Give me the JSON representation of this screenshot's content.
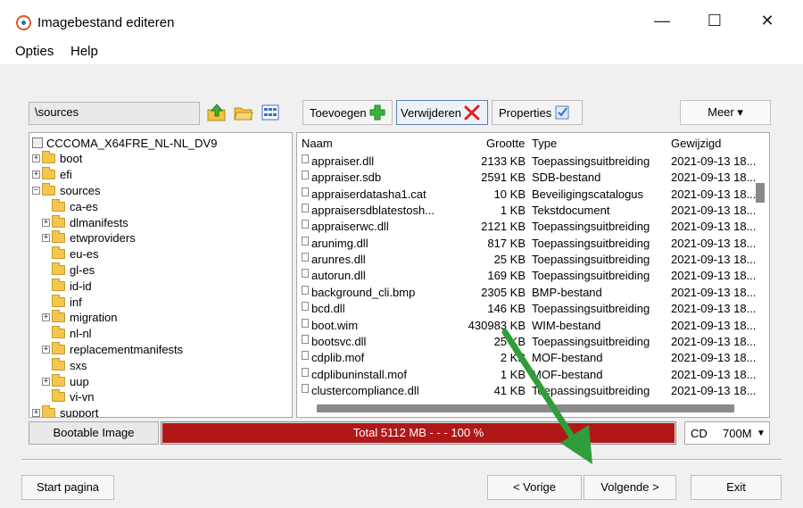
{
  "window": {
    "title": "Imagebestand editeren",
    "min_glyph": "—",
    "max_glyph": "☐",
    "close_glyph": "✕"
  },
  "menu": {
    "items": [
      "Opties",
      "Help"
    ]
  },
  "path": {
    "value": "\\sources"
  },
  "toolbar": {
    "add_label": "Toevoegen",
    "remove_label": "Verwijderen",
    "properties_label": "Properties",
    "more_label": "Meer ▾"
  },
  "tree": {
    "root": "CCCOMA_X64FRE_NL-NL_DV9",
    "items": [
      {
        "label": "boot",
        "level": 1,
        "expander": "+"
      },
      {
        "label": "efi",
        "level": 1,
        "expander": "+"
      },
      {
        "label": "sources",
        "level": 1,
        "expander": "−"
      },
      {
        "label": "ca-es",
        "level": 2,
        "expander": ""
      },
      {
        "label": "dlmanifests",
        "level": 2,
        "expander": "+"
      },
      {
        "label": "etwproviders",
        "level": 2,
        "expander": "+"
      },
      {
        "label": "eu-es",
        "level": 2,
        "expander": ""
      },
      {
        "label": "gl-es",
        "level": 2,
        "expander": ""
      },
      {
        "label": "id-id",
        "level": 2,
        "expander": ""
      },
      {
        "label": "inf",
        "level": 2,
        "expander": ""
      },
      {
        "label": "migration",
        "level": 2,
        "expander": "+"
      },
      {
        "label": "nl-nl",
        "level": 2,
        "expander": ""
      },
      {
        "label": "replacementmanifests",
        "level": 2,
        "expander": "+"
      },
      {
        "label": "sxs",
        "level": 2,
        "expander": ""
      },
      {
        "label": "uup",
        "level": 2,
        "expander": "+"
      },
      {
        "label": "vi-vn",
        "level": 2,
        "expander": ""
      },
      {
        "label": "support",
        "level": 1,
        "expander": "+"
      }
    ]
  },
  "filelist": {
    "columns": {
      "name": "Naam",
      "size": "Grootte",
      "type": "Type",
      "modified": "Gewijzigd"
    },
    "rows": [
      {
        "name": "appraiser.dll",
        "size": "2133 KB",
        "type": "Toepassingsuitbreiding",
        "modified": "2021-09-13 18..."
      },
      {
        "name": "appraiser.sdb",
        "size": "2591 KB",
        "type": "SDB-bestand",
        "modified": "2021-09-13 18..."
      },
      {
        "name": "appraiserdatasha1.cat",
        "size": "10 KB",
        "type": "Beveiligingscatalogus",
        "modified": "2021-09-13 18..."
      },
      {
        "name": "appraisersdblatestosh...",
        "size": "1 KB",
        "type": "Tekstdocument",
        "modified": "2021-09-13 18..."
      },
      {
        "name": "appraiserwc.dll",
        "size": "2121 KB",
        "type": "Toepassingsuitbreiding",
        "modified": "2021-09-13 18..."
      },
      {
        "name": "arunimg.dll",
        "size": "817 KB",
        "type": "Toepassingsuitbreiding",
        "modified": "2021-09-13 18..."
      },
      {
        "name": "arunres.dll",
        "size": "25 KB",
        "type": "Toepassingsuitbreiding",
        "modified": "2021-09-13 18..."
      },
      {
        "name": "autorun.dll",
        "size": "169 KB",
        "type": "Toepassingsuitbreiding",
        "modified": "2021-09-13 18..."
      },
      {
        "name": "background_cli.bmp",
        "size": "2305 KB",
        "type": "BMP-bestand",
        "modified": "2021-09-13 18..."
      },
      {
        "name": "bcd.dll",
        "size": "146 KB",
        "type": "Toepassingsuitbreiding",
        "modified": "2021-09-13 18..."
      },
      {
        "name": "boot.wim",
        "size": "430983 KB",
        "type": "WIM-bestand",
        "modified": "2021-09-13 18..."
      },
      {
        "name": "bootsvc.dll",
        "size": "25 KB",
        "type": "Toepassingsuitbreiding",
        "modified": "2021-09-13 18..."
      },
      {
        "name": "cdplib.mof",
        "size": "2 KB",
        "type": "MOF-bestand",
        "modified": "2021-09-13 18..."
      },
      {
        "name": "cdplibuninstall.mof",
        "size": "1 KB",
        "type": "MOF-bestand",
        "modified": "2021-09-13 18..."
      },
      {
        "name": "clustercompliance.dll",
        "size": "41 KB",
        "type": "Toepassingsuitbreiding",
        "modified": "2021-09-13 18..."
      }
    ]
  },
  "status": {
    "image_label": "Bootable Image",
    "progress_text": "Total  5112 MB  - - -  100 %",
    "progress_fraction": 1.0,
    "media": "CD",
    "media_size": "700M",
    "media_arrow": "▼"
  },
  "nav": {
    "start": "Start pagina",
    "previous": "< Vorige",
    "next": "Volgende >",
    "exit": "Exit"
  },
  "colors": {
    "progress": "#b01818",
    "arrow": "#2f9e3a",
    "remove_x": "#d22",
    "add_plus": "#3cb43c"
  }
}
